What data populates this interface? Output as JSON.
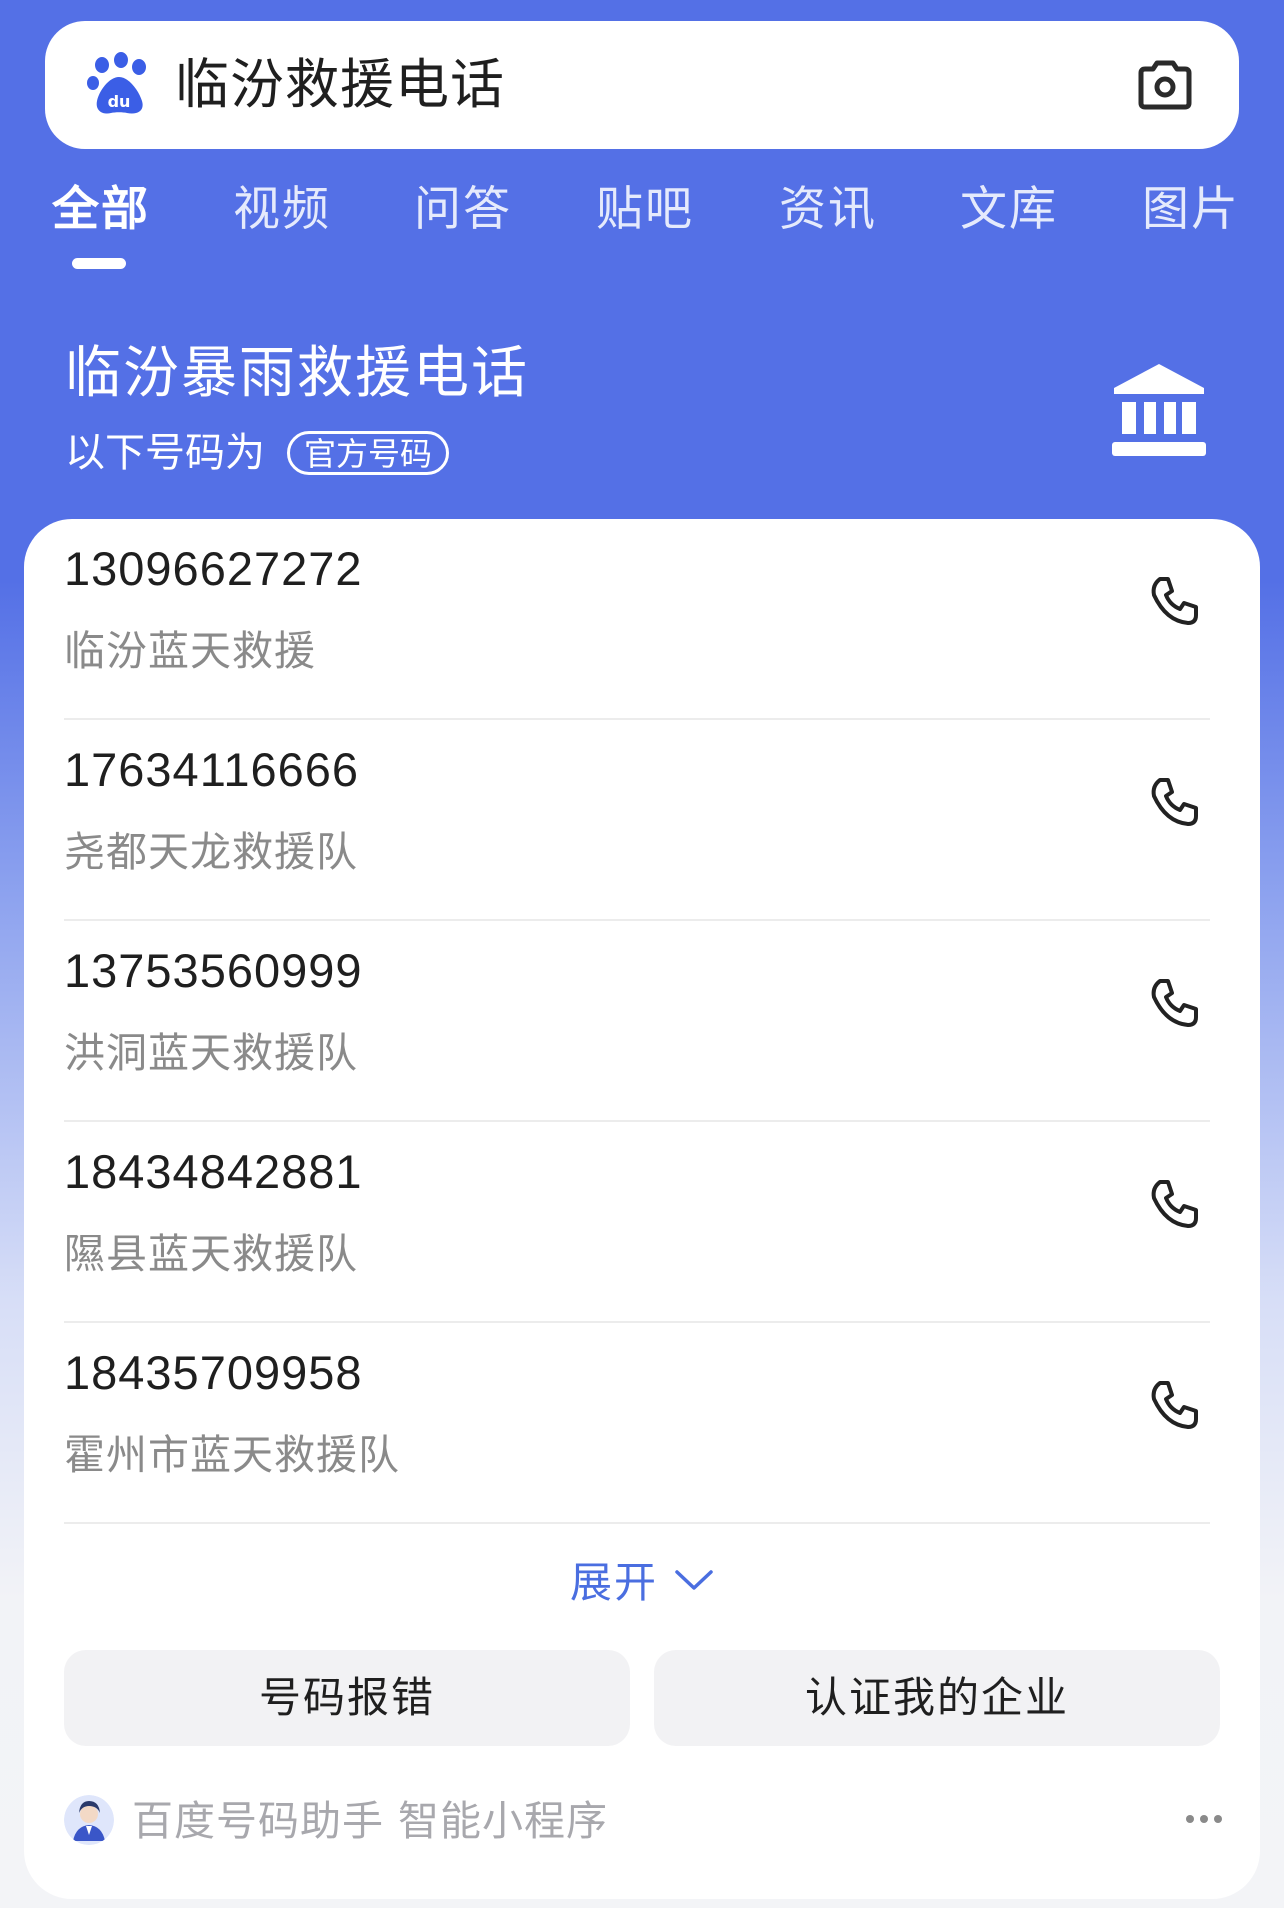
{
  "search": {
    "query": "临汾救援电话",
    "logo_icon": "baidu-paw-icon",
    "camera_icon": "camera-icon"
  },
  "tabs": [
    {
      "label": "全部",
      "active": true
    },
    {
      "label": "视频",
      "active": false
    },
    {
      "label": "问答",
      "active": false
    },
    {
      "label": "贴吧",
      "active": false
    },
    {
      "label": "资讯",
      "active": false
    },
    {
      "label": "文库",
      "active": false
    },
    {
      "label": "图片",
      "active": false
    }
  ],
  "result": {
    "title": "临汾暴雨救援电话",
    "subtitle": "以下号码为",
    "badge": "官方号码",
    "icon": "government-building-icon"
  },
  "contacts": [
    {
      "number": "13096627272",
      "name": "临汾蓝天救援"
    },
    {
      "number": "17634116666",
      "name": "尧都天龙救援队"
    },
    {
      "number": "13753560999",
      "name": "洪洞蓝天救援队"
    },
    {
      "number": "18434842881",
      "name": "隰县蓝天救援队"
    },
    {
      "number": "18435709958",
      "name": "霍州市蓝天救援队"
    }
  ],
  "expand_label": "展开",
  "actions": {
    "report_error": "号码报错",
    "certify_business": "认证我的企业"
  },
  "footer": {
    "text": "百度号码助手 智能小程序",
    "more_icon": "more-dots-icon"
  },
  "colors": {
    "brand_blue": "#5470e6",
    "link_blue": "#4a6ee0"
  }
}
